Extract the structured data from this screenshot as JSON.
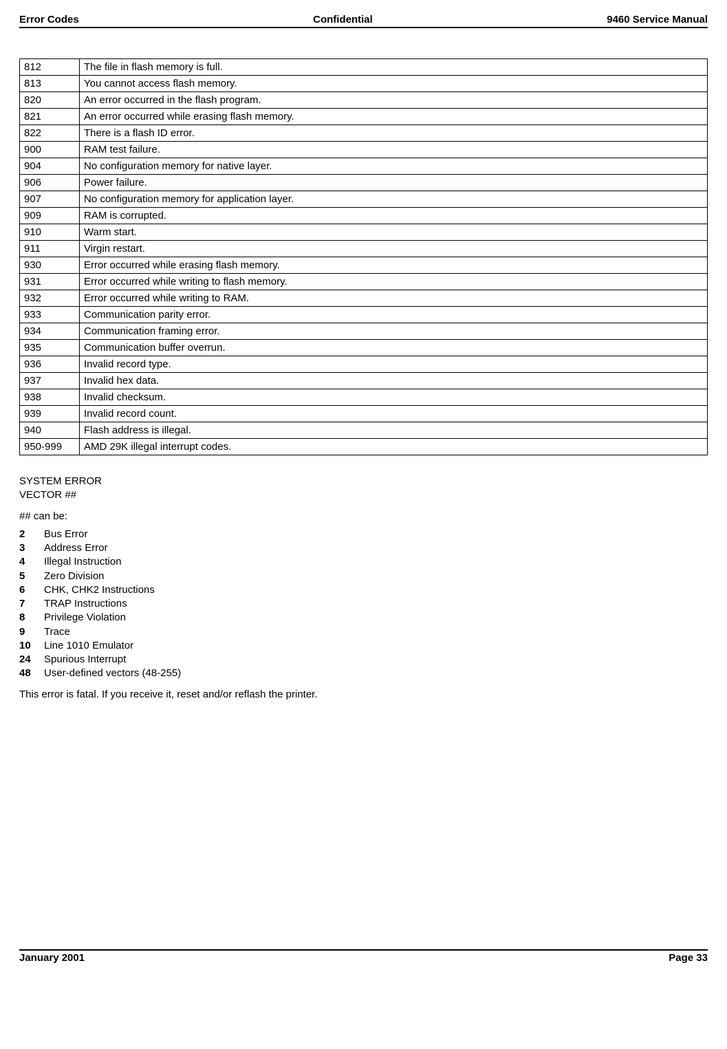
{
  "header": {
    "left": "Error Codes",
    "center": "Confidential",
    "right": "9460 Service Manual"
  },
  "footer": {
    "left": "January 2001",
    "right": "Page 33"
  },
  "error_table": [
    {
      "code": "812",
      "desc": "The file in flash memory is full."
    },
    {
      "code": "813",
      "desc": "You cannot access flash memory."
    },
    {
      "code": "820",
      "desc": "An error occurred in the flash program."
    },
    {
      "code": "821",
      "desc": "An error occurred while erasing flash memory."
    },
    {
      "code": "822",
      "desc": "There is a flash ID error."
    },
    {
      "code": "900",
      "desc": "RAM test failure."
    },
    {
      "code": "904",
      "desc": "No configuration memory for native layer."
    },
    {
      "code": "906",
      "desc": "Power failure."
    },
    {
      "code": "907",
      "desc": "No configuration memory for application layer."
    },
    {
      "code": "909",
      "desc": "RAM is corrupted."
    },
    {
      "code": "910",
      "desc": "Warm start."
    },
    {
      "code": "911",
      "desc": "Virgin restart."
    },
    {
      "code": "930",
      "desc": "Error occurred while erasing flash memory."
    },
    {
      "code": "931",
      "desc": "Error occurred while writing to flash memory."
    },
    {
      "code": "932",
      "desc": "Error occurred while writing to RAM."
    },
    {
      "code": "933",
      "desc": "Communication parity error."
    },
    {
      "code": "934",
      "desc": "Communication framing error."
    },
    {
      "code": "935",
      "desc": "Communication buffer overrun."
    },
    {
      "code": "936",
      "desc": "Invalid record type."
    },
    {
      "code": "937",
      "desc": "Invalid hex data."
    },
    {
      "code": "938",
      "desc": "Invalid checksum."
    },
    {
      "code": "939",
      "desc": "Invalid record count."
    },
    {
      "code": "940",
      "desc": "Flash address is illegal."
    },
    {
      "code": "950-999",
      "desc": "AMD 29K illegal interrupt codes."
    }
  ],
  "system_error": {
    "line1": "SYSTEM ERROR",
    "line2": "VECTOR ##",
    "can_be_label": "## can be:",
    "vectors": [
      {
        "num": "2",
        "desc": "Bus Error"
      },
      {
        "num": "3",
        "desc": "Address Error"
      },
      {
        "num": "4",
        "desc": "Illegal Instruction"
      },
      {
        "num": "5",
        "desc": "Zero Division"
      },
      {
        "num": "6",
        "desc": "CHK, CHK2 Instructions"
      },
      {
        "num": "7",
        "desc": "TRAP Instructions"
      },
      {
        "num": "8",
        "desc": "Privilege Violation"
      },
      {
        "num": "9",
        "desc": "Trace"
      },
      {
        "num": "10",
        "desc": "Line 1010 Emulator"
      },
      {
        "num": "24",
        "desc": "Spurious Interrupt"
      },
      {
        "num": "48",
        "desc": "User-defined vectors (48-255)"
      }
    ],
    "closing": "This error is fatal.  If you receive it, reset and/or reflash the printer."
  }
}
